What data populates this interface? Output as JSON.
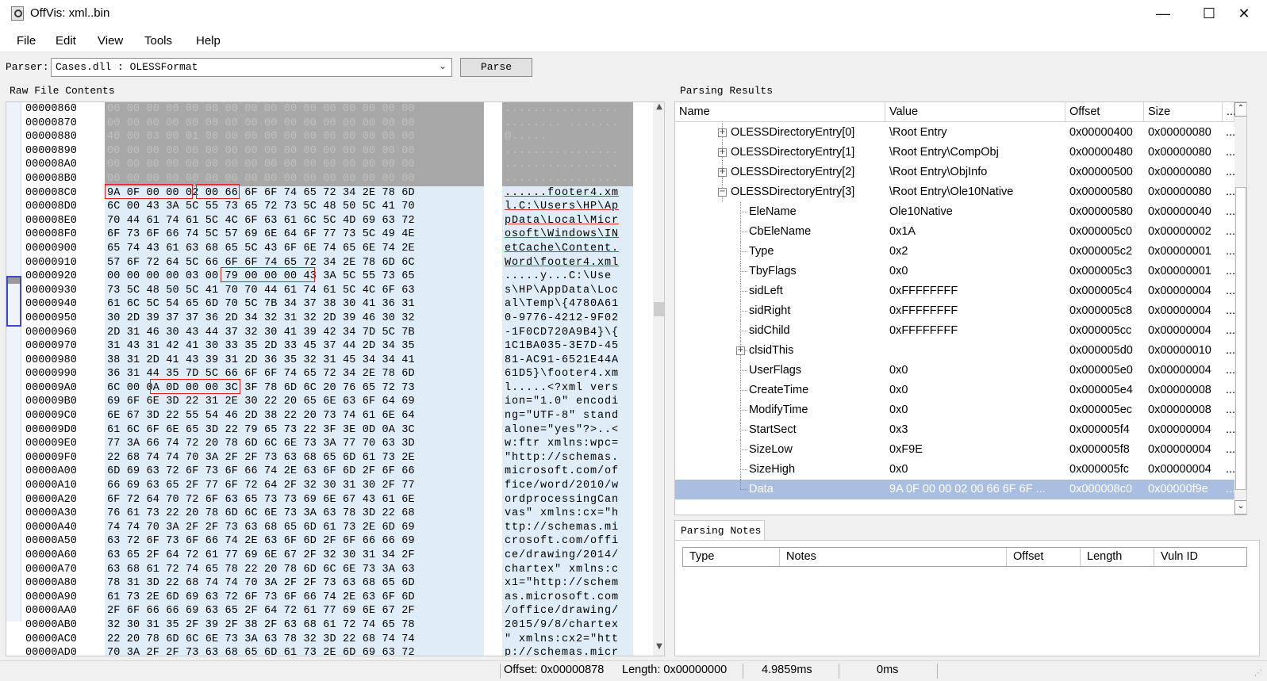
{
  "window": {
    "title": "OffVis: xml..bin",
    "minimize": "—",
    "maximize": "☐",
    "close": "✕"
  },
  "menu": [
    "File",
    "Edit",
    "View",
    "Tools",
    "Help"
  ],
  "parser": {
    "label": "Parser:",
    "selected": "Cases.dll : OLESSFormat",
    "button": "Parse"
  },
  "raw_panel": {
    "label": "Raw File Contents",
    "rows": [
      {
        "addr": "00000860",
        "hex": "00 00 00 00 00 00 00 00 00 00 00 00 00 00 00 00",
        "ascii": "................",
        "style": "grey"
      },
      {
        "addr": "00000870",
        "hex": "00 00 00 00 00 00 00 00 00 00 00 00 00 00 00 00",
        "ascii": "........ .......",
        "style": "grey"
      },
      {
        "addr": "00000880",
        "hex": "40 00 03 00 01 00 00 00 00 00 00 00 00 00 00 00",
        "ascii": "@.....",
        "style": "grey"
      },
      {
        "addr": "00000890",
        "hex": "00 00 00 00 00 00 00 00 00 00 00 00 00 00 00 00",
        "ascii": "................",
        "style": "grey"
      },
      {
        "addr": "000008A0",
        "hex": "00 00 00 00 00 00 00 00 00 00 00 00 00 00 00 00",
        "ascii": "................",
        "style": "grey"
      },
      {
        "addr": "000008B0",
        "hex": "00 00 00 00 00 00 00 00 00 00 00 00 00 00 00 00",
        "ascii": "................",
        "style": "grey"
      },
      {
        "addr": "000008C0",
        "hex": "9A 0F 00 00 02 00 66 6F 6F 74 65 72 34 2E 78 6D",
        "ascii": "......footer4.xm",
        "style": "blue"
      },
      {
        "addr": "000008D0",
        "hex": "6C 00 43 3A 5C 55 73 65 72 73 5C 48 50 5C 41 70",
        "ascii": "l.C:\\Users\\HP\\Ap",
        "style": "blue"
      },
      {
        "addr": "000008E0",
        "hex": "70 44 61 74 61 5C 4C 6F 63 61 6C 5C 4D 69 63 72",
        "ascii": "pData\\Local\\Micr",
        "style": "blue"
      },
      {
        "addr": "000008F0",
        "hex": "6F 73 6F 66 74 5C 57 69 6E 64 6F 77 73 5C 49 4E",
        "ascii": "osoft\\Windows\\IN",
        "style": "blue"
      },
      {
        "addr": "00000900",
        "hex": "65 74 43 61 63 68 65 5C 43 6F 6E 74 65 6E 74 2E",
        "ascii": "etCache\\Content.",
        "style": "blue"
      },
      {
        "addr": "00000910",
        "hex": "57 6F 72 64 5C 66 6F 6F 74 65 72 34 2E 78 6D 6C",
        "ascii": "Word\\footer4.xml",
        "style": "blue"
      },
      {
        "addr": "00000920",
        "hex": "00 00 00 00 03 00 79 00 00 00 43 3A 5C 55 73 65",
        "ascii": ".....y...C:\\Use",
        "style": "blue"
      },
      {
        "addr": "00000930",
        "hex": "73 5C 48 50 5C 41 70 70 44 61 74 61 5C 4C 6F 63",
        "ascii": "s\\HP\\AppData\\Loc",
        "style": "blue"
      },
      {
        "addr": "00000940",
        "hex": "61 6C 5C 54 65 6D 70 5C 7B 34 37 38 30 41 36 31",
        "ascii": "al\\Temp\\{4780A61",
        "style": "blue"
      },
      {
        "addr": "00000950",
        "hex": "30 2D 39 37 37 36 2D 34 32 31 32 2D 39 46 30 32",
        "ascii": "0-9776-4212-9F02",
        "style": "blue"
      },
      {
        "addr": "00000960",
        "hex": "2D 31 46 30 43 44 37 32 30 41 39 42 34 7D 5C 7B",
        "ascii": "-1F0CD720A9B4}\\{",
        "style": "blue"
      },
      {
        "addr": "00000970",
        "hex": "31 43 31 42 41 30 33 35 2D 33 45 37 44 2D 34 35",
        "ascii": "1C1BA035-3E7D-45",
        "style": "blue"
      },
      {
        "addr": "00000980",
        "hex": "38 31 2D 41 43 39 31 2D 36 35 32 31 45 34 34 41",
        "ascii": "81-AC91-6521E44A",
        "style": "blue"
      },
      {
        "addr": "00000990",
        "hex": "36 31 44 35 7D 5C 66 6F 6F 74 65 72 34 2E 78 6D",
        "ascii": "61D5}\\footer4.xm",
        "style": "blue"
      },
      {
        "addr": "000009A0",
        "hex": "6C 00 0A 0D 00 00 3C 3F 78 6D 6C 20 76 65 72 73",
        "ascii": "l.....<?xml vers",
        "style": "blue"
      },
      {
        "addr": "000009B0",
        "hex": "69 6F 6E 3D 22 31 2E 30 22 20 65 6E 63 6F 64 69",
        "ascii": "ion=\"1.0\" encodi",
        "style": "blue"
      },
      {
        "addr": "000009C0",
        "hex": "6E 67 3D 22 55 54 46 2D 38 22 20 73 74 61 6E 64",
        "ascii": "ng=\"UTF-8\" stand",
        "style": "blue"
      },
      {
        "addr": "000009D0",
        "hex": "61 6C 6F 6E 65 3D 22 79 65 73 22 3F 3E 0D 0A 3C",
        "ascii": "alone=\"yes\"?>..<",
        "style": "blue"
      },
      {
        "addr": "000009E0",
        "hex": "77 3A 66 74 72 20 78 6D 6C 6E 73 3A 77 70 63 3D",
        "ascii": "w:ftr xmlns:wpc=",
        "style": "blue"
      },
      {
        "addr": "000009F0",
        "hex": "22 68 74 74 70 3A 2F 2F 73 63 68 65 6D 61 73 2E",
        "ascii": "\"http://schemas.",
        "style": "blue"
      },
      {
        "addr": "00000A00",
        "hex": "6D 69 63 72 6F 73 6F 66 74 2E 63 6F 6D 2F 6F 66",
        "ascii": "microsoft.com/of",
        "style": "blue"
      },
      {
        "addr": "00000A10",
        "hex": "66 69 63 65 2F 77 6F 72 64 2F 32 30 31 30 2F 77",
        "ascii": "fice/word/2010/w",
        "style": "blue"
      },
      {
        "addr": "00000A20",
        "hex": "6F 72 64 70 72 6F 63 65 73 73 69 6E 67 43 61 6E",
        "ascii": "ordprocessingCan",
        "style": "blue"
      },
      {
        "addr": "00000A30",
        "hex": "76 61 73 22 20 78 6D 6C 6E 73 3A 63 78 3D 22 68",
        "ascii": "vas\" xmlns:cx=\"h",
        "style": "blue"
      },
      {
        "addr": "00000A40",
        "hex": "74 74 70 3A 2F 2F 73 63 68 65 6D 61 73 2E 6D 69",
        "ascii": "ttp://schemas.mi",
        "style": "blue"
      },
      {
        "addr": "00000A50",
        "hex": "63 72 6F 73 6F 66 74 2E 63 6F 6D 2F 6F 66 66 69",
        "ascii": "crosoft.com/offi",
        "style": "blue"
      },
      {
        "addr": "00000A60",
        "hex": "63 65 2F 64 72 61 77 69 6E 67 2F 32 30 31 34 2F",
        "ascii": "ce/drawing/2014/",
        "style": "blue"
      },
      {
        "addr": "00000A70",
        "hex": "63 68 61 72 74 65 78 22 20 78 6D 6C 6E 73 3A 63",
        "ascii": "chartex\" xmlns:c",
        "style": "blue"
      },
      {
        "addr": "00000A80",
        "hex": "78 31 3D 22 68 74 74 70 3A 2F 2F 73 63 68 65 6D",
        "ascii": "x1=\"http://schem",
        "style": "blue"
      },
      {
        "addr": "00000A90",
        "hex": "61 73 2E 6D 69 63 72 6F 73 6F 66 74 2E 63 6F 6D",
        "ascii": "as.microsoft.com",
        "style": "blue"
      },
      {
        "addr": "00000AA0",
        "hex": "2F 6F 66 66 69 63 65 2F 64 72 61 77 69 6E 67 2F",
        "ascii": "/office/drawing/",
        "style": "blue"
      },
      {
        "addr": "00000AB0",
        "hex": "32 30 31 35 2F 39 2F 38 2F 63 68 61 72 74 65 78",
        "ascii": "2015/9/8/chartex",
        "style": "blue"
      },
      {
        "addr": "00000AC0",
        "hex": "22 20 78 6D 6C 6E 73 3A 63 78 32 3D 22 68 74 74",
        "ascii": "\" xmlns:cx2=\"htt",
        "style": "blue"
      },
      {
        "addr": "00000AD0",
        "hex": "70 3A 2F 2F 73 63 68 65 6D 61 73 2E 6D 69 63 72",
        "ascii": "p://schemas.micr",
        "style": "blue"
      }
    ]
  },
  "results_panel": {
    "label": "Parsing Results",
    "columns": [
      "Name",
      "Value",
      "Offset",
      "Size",
      "..."
    ],
    "rows": [
      {
        "name": "OLESSDirectoryEntry[0]",
        "value": "\\Root Entry",
        "offset": "0x00000400",
        "size": "0x00000080",
        "more": "...",
        "level": 0,
        "expander": "+"
      },
      {
        "name": "OLESSDirectoryEntry[1]",
        "value": "\\Root Entry\\\u0001CompObj",
        "offset": "0x00000480",
        "size": "0x00000080",
        "more": "...",
        "level": 0,
        "expander": "+"
      },
      {
        "name": "OLESSDirectoryEntry[2]",
        "value": "\\Root Entry\\\u0001ObjInfo",
        "offset": "0x00000500",
        "size": "0x00000080",
        "more": "...",
        "level": 0,
        "expander": "+"
      },
      {
        "name": "OLESSDirectoryEntry[3]",
        "value": "\\Root Entry\\\u0001Ole10Native",
        "offset": "0x00000580",
        "size": "0x00000080",
        "more": "...",
        "level": 0,
        "expander": "-"
      },
      {
        "name": "EleName",
        "value": "\u0001Ole10Native",
        "offset": "0x00000580",
        "size": "0x00000040",
        "more": "...",
        "level": 1,
        "expander": ""
      },
      {
        "name": "CbEleName",
        "value": "0x1A",
        "offset": "0x000005c0",
        "size": "0x00000002",
        "more": "...",
        "level": 1,
        "expander": ""
      },
      {
        "name": "Type",
        "value": "0x2",
        "offset": "0x000005c2",
        "size": "0x00000001",
        "more": "...",
        "level": 1,
        "expander": ""
      },
      {
        "name": "TbyFlags",
        "value": "0x0",
        "offset": "0x000005c3",
        "size": "0x00000001",
        "more": "...",
        "level": 1,
        "expander": ""
      },
      {
        "name": "sidLeft",
        "value": "0xFFFFFFFF",
        "offset": "0x000005c4",
        "size": "0x00000004",
        "more": "...",
        "level": 1,
        "expander": ""
      },
      {
        "name": "sidRight",
        "value": "0xFFFFFFFF",
        "offset": "0x000005c8",
        "size": "0x00000004",
        "more": "...",
        "level": 1,
        "expander": ""
      },
      {
        "name": "sidChild",
        "value": "0xFFFFFFFF",
        "offset": "0x000005cc",
        "size": "0x00000004",
        "more": "...",
        "level": 1,
        "expander": ""
      },
      {
        "name": "clsidThis",
        "value": "",
        "offset": "0x000005d0",
        "size": "0x00000010",
        "more": "...",
        "level": 1,
        "expander": "+"
      },
      {
        "name": "UserFlags",
        "value": "0x0",
        "offset": "0x000005e0",
        "size": "0x00000004",
        "more": "...",
        "level": 1,
        "expander": ""
      },
      {
        "name": "CreateTime",
        "value": "0x0",
        "offset": "0x000005e4",
        "size": "0x00000008",
        "more": "...",
        "level": 1,
        "expander": ""
      },
      {
        "name": "ModifyTime",
        "value": "0x0",
        "offset": "0x000005ec",
        "size": "0x00000008",
        "more": "...",
        "level": 1,
        "expander": ""
      },
      {
        "name": "StartSect",
        "value": "0x3",
        "offset": "0x000005f4",
        "size": "0x00000004",
        "more": "...",
        "level": 1,
        "expander": ""
      },
      {
        "name": "SizeLow",
        "value": "0xF9E",
        "offset": "0x000005f8",
        "size": "0x00000004",
        "more": "...",
        "level": 1,
        "expander": ""
      },
      {
        "name": "SizeHigh",
        "value": "0x0",
        "offset": "0x000005fc",
        "size": "0x00000004",
        "more": "...",
        "level": 1,
        "expander": ""
      },
      {
        "name": "Data",
        "value": "9A 0F 00 00 02 00 66 6F 6F ...",
        "offset": "0x000008c0",
        "size": "0x00000f9e",
        "more": "...",
        "level": 1,
        "expander": "",
        "selected": true
      }
    ]
  },
  "notes_panel": {
    "tab": "Parsing Notes",
    "columns": [
      "Type",
      "Notes",
      "Offset",
      "Length",
      "Vuln ID"
    ]
  },
  "status": {
    "offset": "Offset: 0x00000878",
    "length": "Length: 0x00000000",
    "time1": "4.9859ms",
    "time2": "0ms"
  },
  "colors": {
    "selection": "#a9bee0",
    "hex_data_bg": "#deedf8",
    "hex_free_bg": "#a8a8a8",
    "highlight": "#d92020"
  }
}
